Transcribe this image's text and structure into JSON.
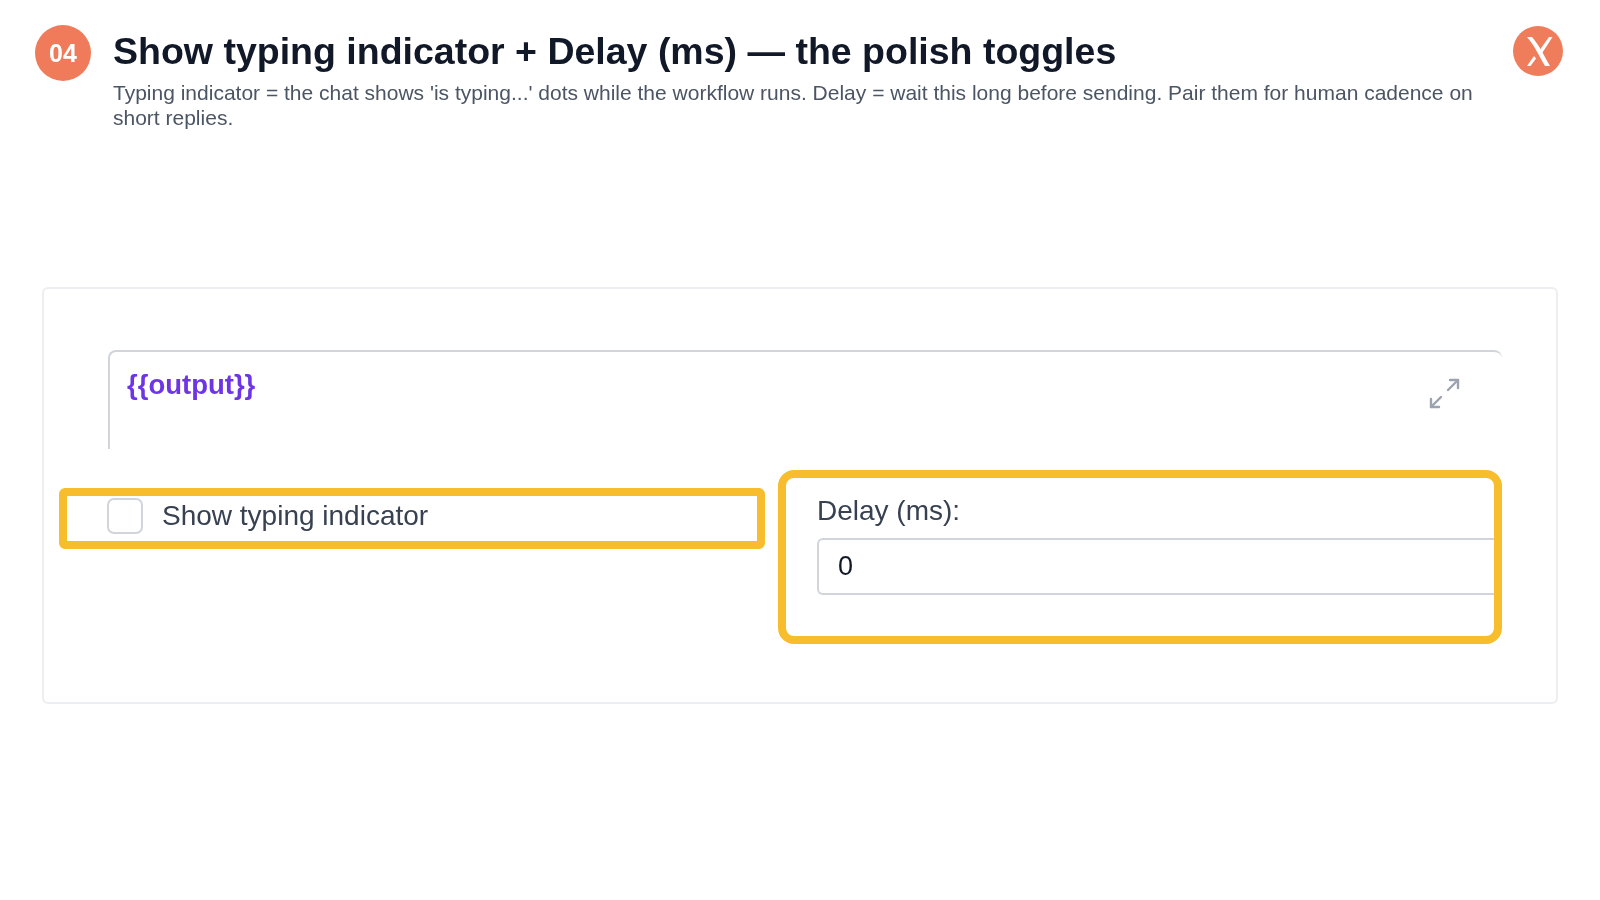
{
  "step": {
    "number": "04",
    "title": "Show typing indicator + Delay (ms) — the polish toggles",
    "description": "Typing indicator = the chat shows 'is typing...' dots while the workflow runs. Delay = wait this long before sending. Pair them for human cadence on short replies."
  },
  "editor": {
    "value": "{{output}}"
  },
  "fields": [
    {
      "kind": "checkbox",
      "label": "Show typing indicator",
      "checked": false,
      "highlighted": true
    },
    {
      "kind": "number",
      "label": "Delay (ms):",
      "value": "0",
      "highlighted": true
    }
  ]
}
